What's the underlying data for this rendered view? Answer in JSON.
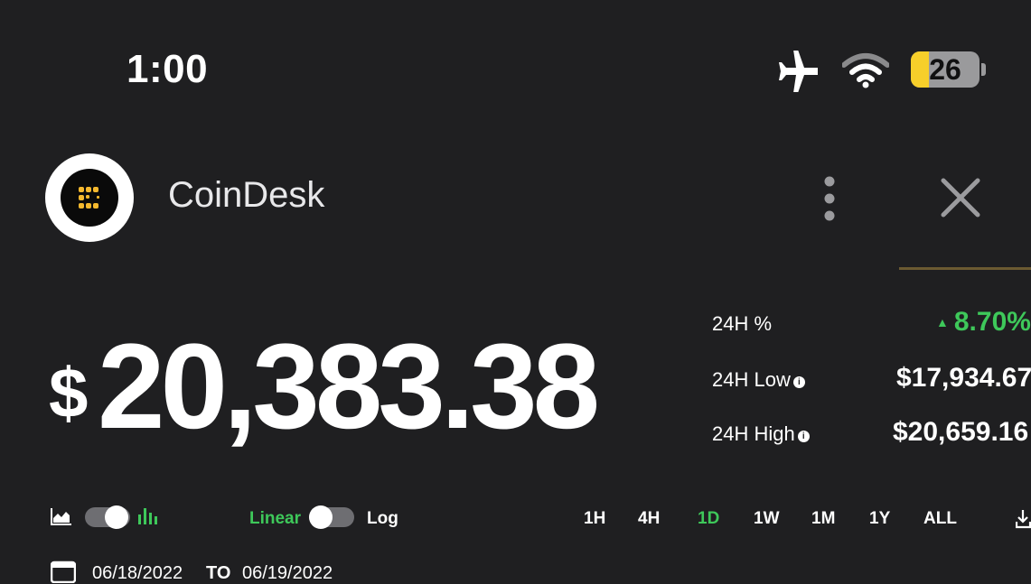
{
  "status_bar": {
    "time": "1:00",
    "battery_level": "26",
    "icons": [
      "airplane-mode-icon",
      "wifi-icon",
      "battery-icon"
    ]
  },
  "header": {
    "site_title": "CoinDesk",
    "icons": [
      "coindesk-logo",
      "more-options-icon",
      "close-icon"
    ]
  },
  "price": {
    "currency": "$",
    "value": "20,383.38"
  },
  "stats": {
    "change_label": "24H %",
    "change_value": "8.70%",
    "low_label": "24H Low",
    "low_value": "$17,934.67",
    "high_label": "24H High",
    "high_value": "$20,659.16"
  },
  "controls": {
    "linear_label": "Linear",
    "log_label": "Log",
    "chart_type": "area",
    "ranges": [
      "1H",
      "4H",
      "1D",
      "1W",
      "1M",
      "1Y",
      "ALL"
    ],
    "active_range": "1D"
  },
  "date_range": {
    "from": "06/18/2022",
    "separator": "TO",
    "to": "06/19/2022"
  },
  "colors": {
    "background": "#1f1f21",
    "positive": "#3ec85a",
    "logo_accent": "#f5b82e"
  }
}
